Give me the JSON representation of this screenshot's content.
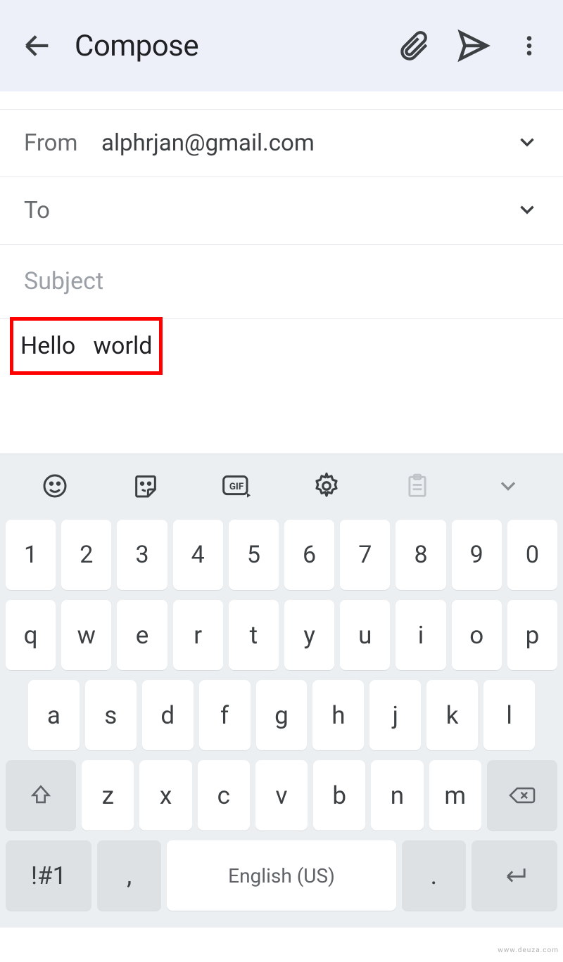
{
  "header": {
    "title": "Compose"
  },
  "fields": {
    "from_label": "From",
    "from_value": "alphrjan@gmail.com",
    "to_label": "To",
    "to_value": "",
    "subject_placeholder": "Subject",
    "subject_value": ""
  },
  "body": {
    "text": "Hello   world"
  },
  "keyboard": {
    "row_numbers": [
      "1",
      "2",
      "3",
      "4",
      "5",
      "6",
      "7",
      "8",
      "9",
      "0"
    ],
    "row_letters1": [
      "q",
      "w",
      "e",
      "r",
      "t",
      "y",
      "u",
      "i",
      "o",
      "p"
    ],
    "row_letters2": [
      "a",
      "s",
      "d",
      "f",
      "g",
      "h",
      "j",
      "k",
      "l"
    ],
    "row_letters3": [
      "z",
      "x",
      "c",
      "v",
      "b",
      "n",
      "m"
    ],
    "sym_label": "!#1",
    "comma": ",",
    "space_label": "English (US)",
    "period": "."
  },
  "watermark": "www.deuza.com"
}
